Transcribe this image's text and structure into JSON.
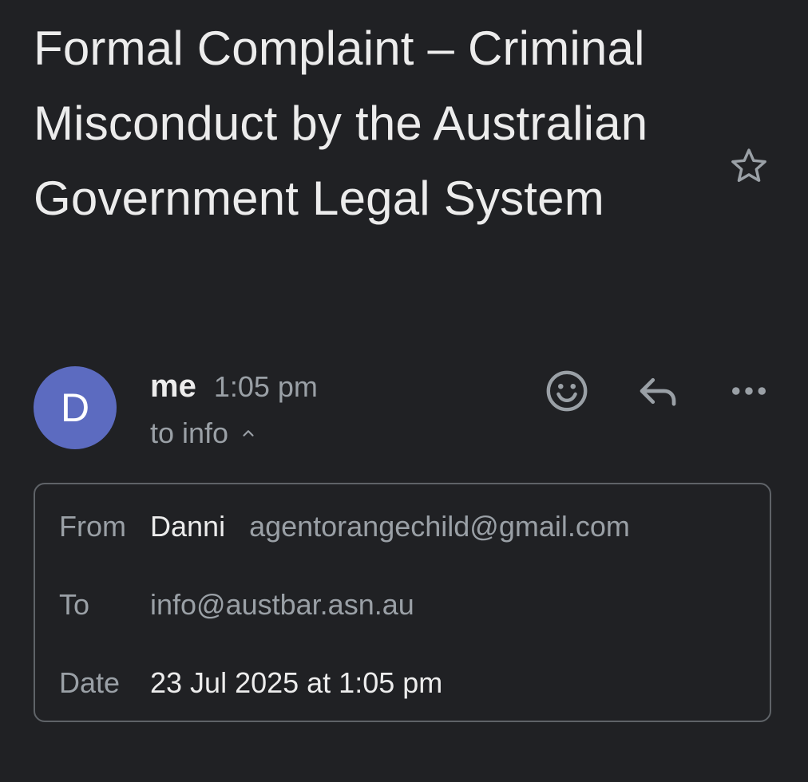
{
  "subject": "Formal Complaint – Criminal Misconduct by the Australian Government Legal System",
  "avatar": {
    "initial": "D",
    "color": "#5c6bc0"
  },
  "sender": {
    "name": "me",
    "time": "1:05 pm",
    "recipient_summary": "to info"
  },
  "icons": {
    "star": "star-outline-icon",
    "emoji": "smiley-icon",
    "reply": "reply-icon",
    "more": "more-horizontal-icon",
    "caret": "chevron-up-icon"
  },
  "details": {
    "from_label": "From",
    "from_name": "Danni",
    "from_email": "agentorangechild@gmail.com",
    "to_label": "To",
    "to_email": "info@austbar.asn.au",
    "date_label": "Date",
    "date_value": "23 Jul 2025 at 1:05 pm"
  },
  "colors": {
    "background": "#202124",
    "text_primary": "#ececec",
    "text_secondary": "#9aa0a6",
    "border": "#5f6368"
  }
}
